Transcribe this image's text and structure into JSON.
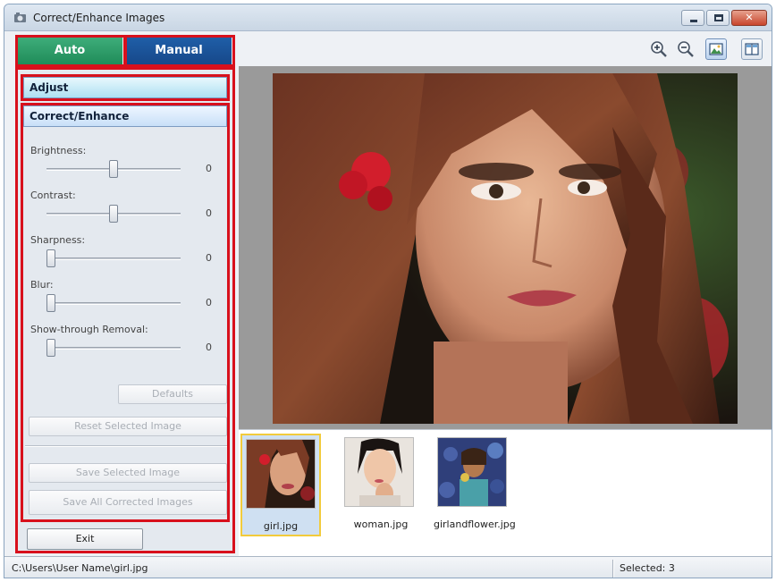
{
  "window": {
    "title": "Correct/Enhance Images"
  },
  "tabs": {
    "auto": "Auto",
    "manual": "Manual"
  },
  "panel": {
    "adjust_label": "Adjust",
    "correct_label": "Correct/Enhance",
    "sliders": [
      {
        "label": "Brightness:",
        "value": "0"
      },
      {
        "label": "Contrast:",
        "value": "0"
      },
      {
        "label": "Sharpness:",
        "value": "0"
      },
      {
        "label": "Blur:",
        "value": "0"
      },
      {
        "label": "Show-through Removal:",
        "value": "0"
      }
    ],
    "defaults_label": "Defaults",
    "reset_label": "Reset Selected Image",
    "save_selected_label": "Save Selected Image",
    "save_all_label": "Save All Corrected Images",
    "exit_label": "Exit"
  },
  "toolbar": {
    "zoom_in_icon": "zoom-in-icon",
    "zoom_out_icon": "zoom-out-icon",
    "whole_image_icon": "view-whole-image-icon",
    "compare_icon": "compare-view-icon"
  },
  "thumbnails": [
    {
      "name": "girl.jpg",
      "selected": true
    },
    {
      "name": "woman.jpg",
      "selected": false
    },
    {
      "name": "girlandflower.jpg",
      "selected": false
    }
  ],
  "status": {
    "path": "C:\\Users\\User Name\\girl.jpg",
    "selected": "Selected: 3"
  },
  "colors": {
    "auto_tab": "#1f8c59",
    "manual_tab": "#17488a",
    "highlight": "#d8101c"
  }
}
